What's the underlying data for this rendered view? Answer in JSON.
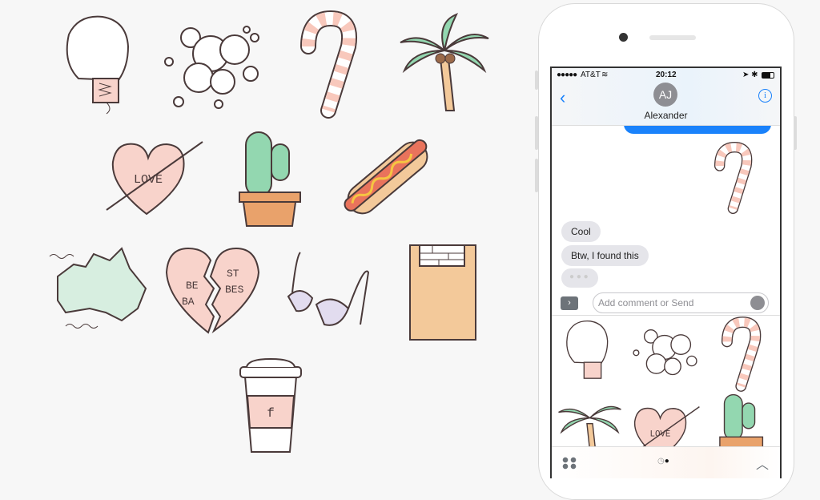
{
  "stickers": {
    "love_heart": "LOVE",
    "broken_heart": {
      "left_top": "BE",
      "left_bottom": "BA",
      "right_top": "ST",
      "right_bottom": "BES"
    },
    "coffee_cup": "f",
    "list": [
      "boxing-glove",
      "bubbles",
      "candy-cane",
      "palm-tree",
      "love-heart",
      "cactus",
      "hot-dog",
      "australia-map",
      "broken-heart",
      "bra",
      "paper-bag",
      "coffee-cup"
    ]
  },
  "phone": {
    "status": {
      "carrier": "AT&T",
      "time": "20:12"
    },
    "header": {
      "avatar_initials": "AJ",
      "contact_name": "Alexander",
      "back_icon": "chevron-left",
      "info_icon": "i"
    },
    "messages": [
      {
        "text": "Cool"
      },
      {
        "text": "Btw, I found this"
      }
    ],
    "input": {
      "placeholder": "Add comment or Send",
      "app_button": "›"
    },
    "colors": {
      "accent": "#1a82fb",
      "bubble_gray": "#e5e5ea",
      "sticker_pink": "#f8d3cb",
      "sticker_green": "#93d7b0"
    }
  }
}
